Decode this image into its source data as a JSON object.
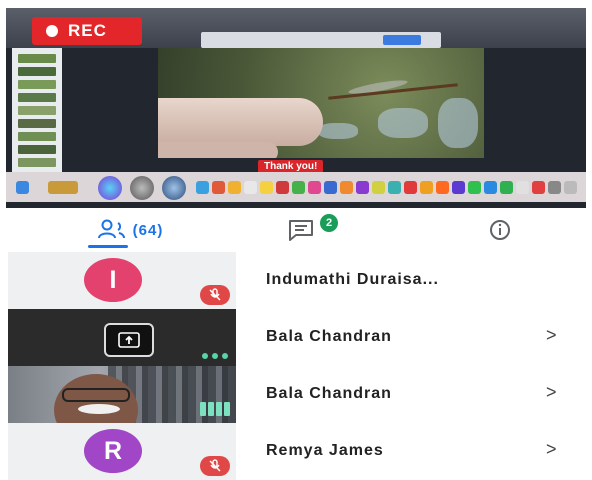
{
  "recording": {
    "label": "REC",
    "color": "#e2262a"
  },
  "shared_screen": {
    "caption": "Thank you!"
  },
  "tabs": {
    "people": {
      "icon": "people-icon",
      "count_label": "(64)"
    },
    "chat": {
      "icon": "chat-icon",
      "badge": "2"
    },
    "info": {
      "icon": "info-icon"
    }
  },
  "participants": [
    {
      "name": "Indumathi Duraisa...",
      "avatar_letter": "I",
      "avatar_color": "#e4426e",
      "muted": true,
      "chevron": ""
    },
    {
      "name": "Bala Chandran",
      "tile": "presenting",
      "chevron": ">"
    },
    {
      "name": "Bala Chandran",
      "tile": "video",
      "chevron": ">"
    },
    {
      "name": "Remya James",
      "avatar_letter": "R",
      "avatar_color": "#a046c6",
      "muted": true,
      "chevron": ">"
    }
  ],
  "colors": {
    "accent": "#1a73e8",
    "mute": "#e04847",
    "chat_badge": "#1a9d58"
  }
}
